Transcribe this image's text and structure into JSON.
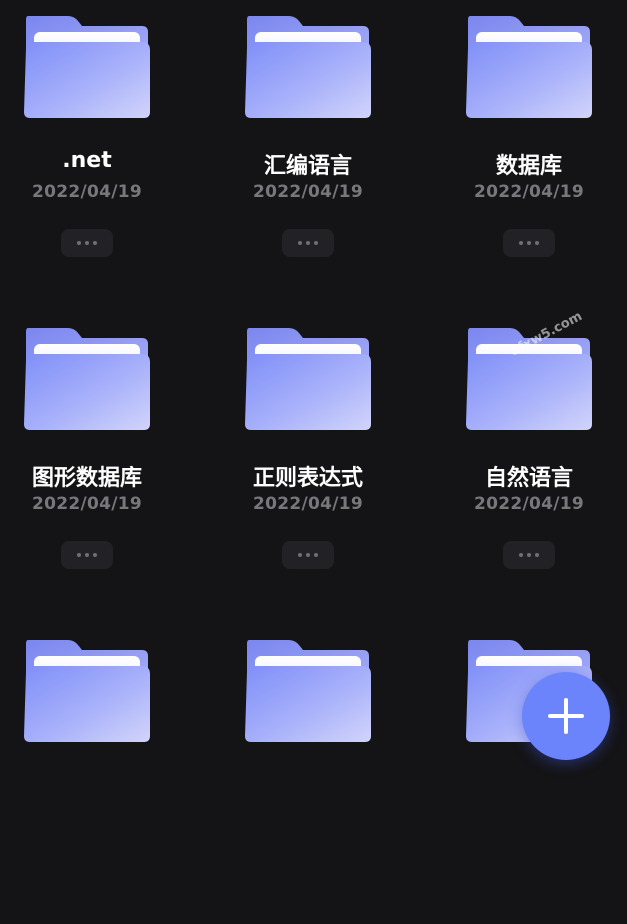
{
  "files": [
    {
      "name": ".net",
      "date": "2022/04/19"
    },
    {
      "name": "汇编语言",
      "date": "2022/04/19"
    },
    {
      "name": "数据库",
      "date": "2022/04/19"
    },
    {
      "name": "图形数据库",
      "date": "2022/04/19"
    },
    {
      "name": "正则表达式",
      "date": "2022/04/19"
    },
    {
      "name": "自然语言",
      "date": "2022/04/19"
    },
    {
      "name": "",
      "date": ""
    },
    {
      "name": "",
      "date": ""
    },
    {
      "name": "",
      "date": ""
    }
  ],
  "icons": {
    "folder": "folder-icon",
    "more": "more-horizontal-icon",
    "add": "plus-icon"
  },
  "colors": {
    "background": "#141416",
    "folder_body": "#8f9cf8",
    "fab": "#6b84fb"
  },
  "watermark": "afxw5.com"
}
